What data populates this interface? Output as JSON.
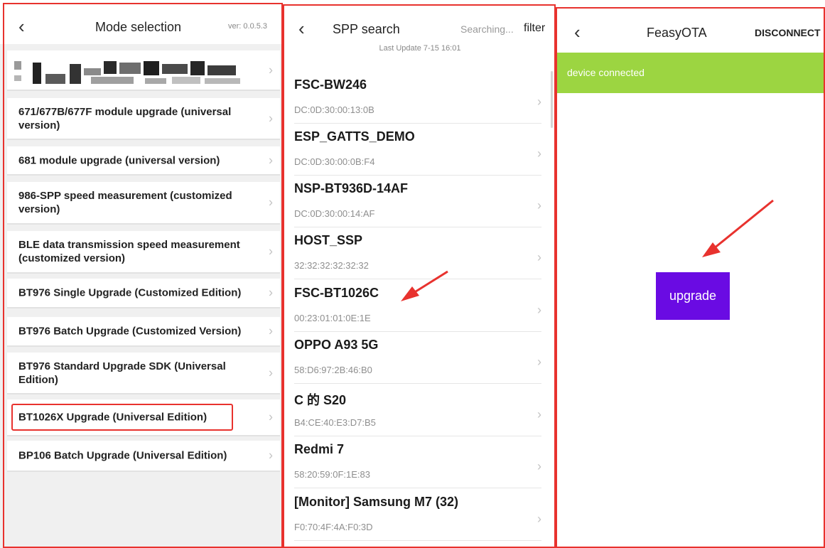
{
  "mode_panel": {
    "title": "Mode selection",
    "version": "ver: 0.0.5.3",
    "items": [
      {
        "label": "671/677B/677F module upgrade (universal version)"
      },
      {
        "label": "681 module upgrade (universal version)"
      },
      {
        "label": "986-SPP speed measurement (customized version)"
      },
      {
        "label": "BLE data transmission speed measurement (customized version)"
      },
      {
        "label": "BT976 Single Upgrade (Customized Edition)"
      },
      {
        "label": "BT976 Batch Upgrade (Customized Version)"
      },
      {
        "label": "BT976 Standard Upgrade SDK (Universal Edition)"
      },
      {
        "label": "BT1026X Upgrade (Universal Edition)"
      },
      {
        "label": "BP106 Batch Upgrade (Universal Edition)"
      }
    ]
  },
  "spp_panel": {
    "title": "SPP search",
    "status": "Searching...",
    "filter_label": "filter",
    "last_update": "Last Update 7-15 16:01",
    "devices": [
      {
        "name": "FSC-BW246",
        "mac": "DC:0D:30:00:13:0B"
      },
      {
        "name": "ESP_GATTS_DEMO",
        "mac": "DC:0D:30:00:0B:F4"
      },
      {
        "name": "NSP-BT936D-14AF",
        "mac": "DC:0D:30:00:14:AF"
      },
      {
        "name": "HOST_SSP",
        "mac": "32:32:32:32:32:32"
      },
      {
        "name": "FSC-BT1026C",
        "mac": "00:23:01:01:0E:1E"
      },
      {
        "name": "OPPO A93 5G",
        "mac": "58:D6:97:2B:46:B0"
      },
      {
        "name": "C 的 S20",
        "mac": "B4:CE:40:E3:D7:B5"
      },
      {
        "name": "Redmi 7",
        "mac": "58:20:59:0F:1E:83"
      },
      {
        "name": "[Monitor] Samsung M7 (32)",
        "mac": "F0:70:4F:4A:F0:3D"
      }
    ]
  },
  "ota_panel": {
    "title": "FeasyOTA",
    "disconnect_label": "DISCONNECT",
    "status": "device connected",
    "upgrade_label": "upgrade"
  },
  "colors": {
    "highlight": "#e8322e",
    "status_bar": "#9cd541",
    "upgrade_button": "#6a0be3"
  },
  "icons": [
    "back-arrow-icon",
    "chevron-right-icon",
    "annotation-arrow-icon"
  ]
}
